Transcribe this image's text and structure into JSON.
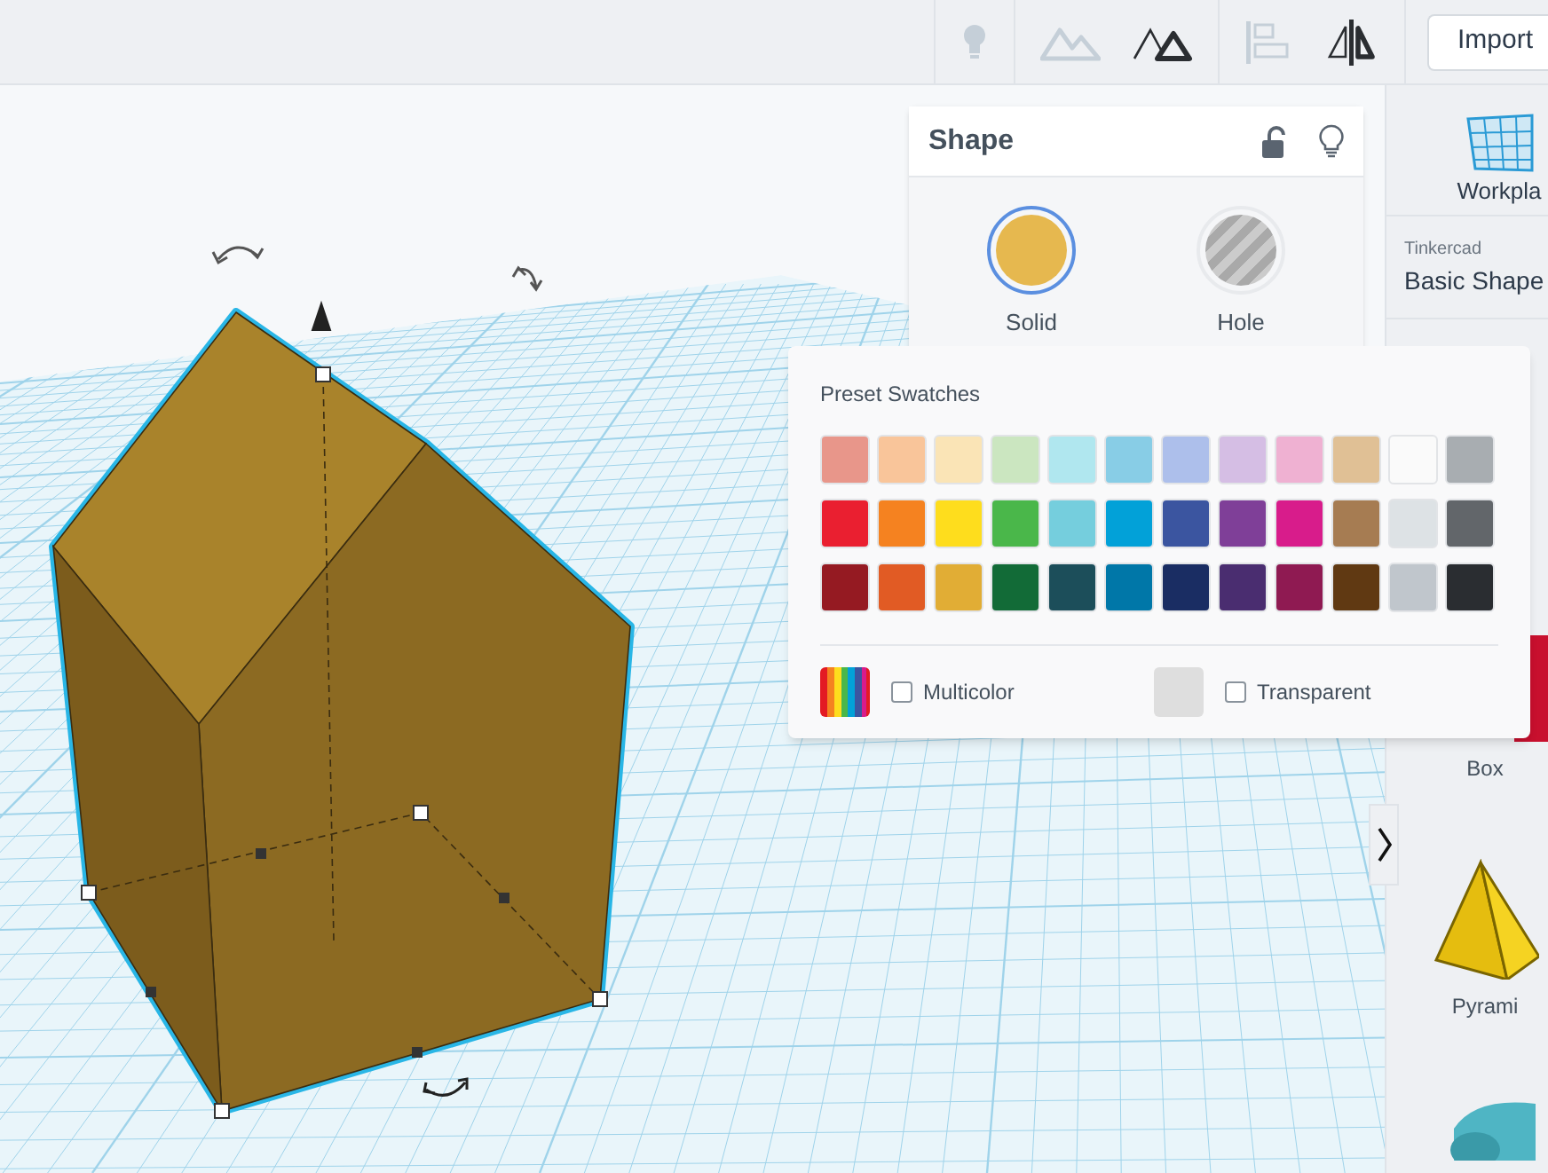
{
  "toolbar": {
    "tools": [
      {
        "kind": "bulb",
        "disabled": true
      },
      {
        "kind": "mountains",
        "disabled": true
      },
      {
        "kind": "triangles",
        "disabled": false
      },
      {
        "kind": "align",
        "disabled": true
      },
      {
        "kind": "mirror",
        "disabled": false
      }
    ],
    "import_button": "Import"
  },
  "shape_panel": {
    "title": "Shape",
    "options": [
      {
        "label": "Solid",
        "kind": "solid",
        "selected": true
      },
      {
        "label": "Hole",
        "kind": "hole",
        "selected": false
      }
    ]
  },
  "color_picker": {
    "title": "Preset Swatches",
    "rows": [
      [
        {
          "color": "#e8968a"
        },
        {
          "color": "#f9c59a"
        },
        {
          "color": "#fae4b6"
        },
        {
          "color": "#cbe6c0"
        },
        {
          "color": "#b0e7ef"
        },
        {
          "color": "#88cde6"
        },
        {
          "color": "#adbfeb"
        },
        {
          "color": "#d5bee4"
        },
        {
          "color": "#efb1d2"
        },
        {
          "color": "#e0c095"
        },
        {
          "color": "#fafafa"
        },
        {
          "color": "#a8adb1"
        }
      ],
      [
        {
          "color": "#ea1f30"
        },
        {
          "color": "#f58220"
        },
        {
          "color": "#fedd1d"
        },
        {
          "color": "#4ab74a"
        },
        {
          "color": "#75cedd"
        },
        {
          "color": "#02a1d8"
        },
        {
          "color": "#3b55a0"
        },
        {
          "color": "#7f3f98"
        },
        {
          "color": "#d81c8b"
        },
        {
          "color": "#a67c52"
        },
        {
          "color": "#dde2e5"
        },
        {
          "color": "#62666a"
        }
      ],
      [
        {
          "color": "#951a22"
        },
        {
          "color": "#e15b24"
        },
        {
          "color": "#e1ad35"
        },
        {
          "color": "#126b37"
        },
        {
          "color": "#1c4e5a"
        },
        {
          "color": "#0077a8"
        },
        {
          "color": "#1a2d63"
        },
        {
          "color": "#4a2d70"
        },
        {
          "color": "#8f1a52"
        },
        {
          "color": "#603912"
        },
        {
          "color": "#c0c6cc"
        },
        {
          "color": "#2a2d31"
        }
      ]
    ],
    "options": [
      {
        "label": "Multicolor",
        "kind": "multicolor",
        "checked": false
      },
      {
        "label": "Transparent",
        "kind": "transparent",
        "checked": false
      }
    ]
  },
  "sidebar": {
    "workplane_label": "Workpla",
    "library_source": "Tinkercad",
    "library_name": "Basic Shape",
    "shapes": [
      {
        "label": "Box",
        "kind": "box"
      },
      {
        "label": "Pyrami",
        "kind": "pyramid"
      },
      {
        "kind": "cylinder"
      }
    ]
  }
}
